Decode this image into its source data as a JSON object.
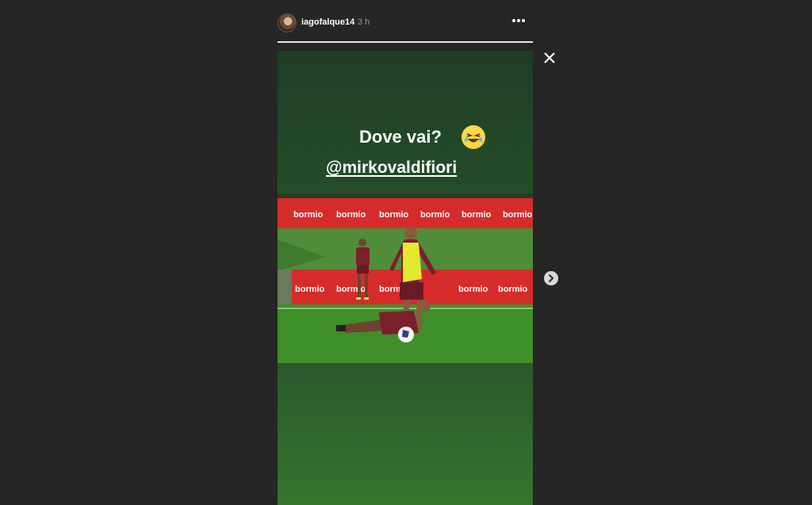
{
  "header": {
    "username": "iagofalque14",
    "time": "3 h",
    "more_icon": "more-horizontal-icon"
  },
  "progress": {
    "fraction": 1.0
  },
  "story": {
    "caption_line1": "Dove vai?",
    "mention": "@mirkovaldifiori",
    "emoji_icon": "rolling-on-floor-laughing-emoji",
    "banner_text": "bormio"
  },
  "controls": {
    "close_icon": "close-icon",
    "next_icon": "chevron-right-icon"
  },
  "colors": {
    "background": "#262626",
    "banner_red": "#d62b2b",
    "grass": "#3e8a2c",
    "jersey": "#7a1f2b",
    "bib": "#e4e82f"
  }
}
